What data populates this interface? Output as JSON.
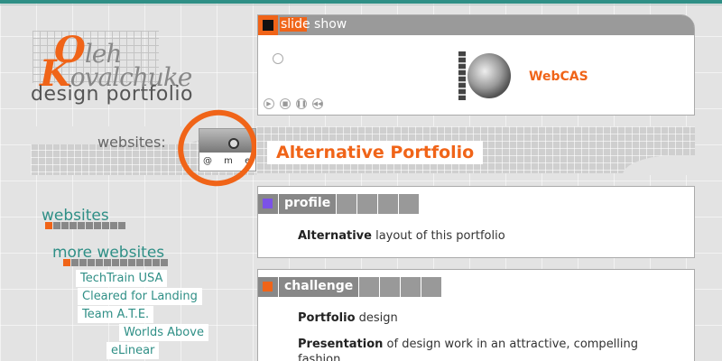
{
  "logo": {
    "first_name_initial": "O",
    "first_name_rest": "leh",
    "last_name_initial": "K",
    "last_name_rest": "ovalchuke",
    "subtitle": "design portfolio"
  },
  "websites_band": {
    "label": "websites:",
    "thumb_text": "@ m e"
  },
  "nav": {
    "websites_title": "websites",
    "more_title": "more websites",
    "links": [
      "TechTrain USA",
      "Cleared for Landing",
      "Team A.T.E.",
      "Worlds Above",
      "eLinear"
    ]
  },
  "slideshow": {
    "title": "slide show",
    "current_item": "WebCAS",
    "controls": [
      "play-icon",
      "stop-icon",
      "pause-icon",
      "rewind-icon"
    ]
  },
  "page_title": "Alternative Portfolio",
  "sections": {
    "profile": {
      "label": "profile",
      "chip_color": "#7b52e8",
      "line1_bold": "Alternative",
      "line1_rest": " layout of this portfolio"
    },
    "challenge": {
      "label": "challenge",
      "chip_color": "#f06418",
      "line1_bold": "Portfolio",
      "line1_rest": " design",
      "line2_bold": "Presentation",
      "line2_rest": " of design work in an attractive, compelling fashion"
    }
  },
  "colors": {
    "accent": "#f06418",
    "teal": "#2f8f86",
    "grey": "#888888"
  }
}
